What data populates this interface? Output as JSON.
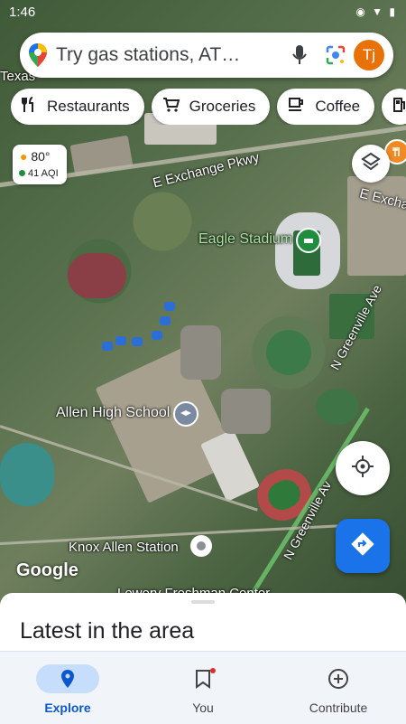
{
  "status_bar": {
    "time": "1:46",
    "system_icons": "◉ ▼ ▮"
  },
  "search": {
    "placeholder": "Try gas stations, AT…",
    "avatar_initials": "Tj"
  },
  "chips": [
    {
      "label": "Restaurants",
      "icon": "fork-knife-icon"
    },
    {
      "label": "Groceries",
      "icon": "cart-icon"
    },
    {
      "label": "Coffee",
      "icon": "coffee-icon"
    }
  ],
  "weather": {
    "temp": "80°",
    "aqi": "41 AQI"
  },
  "map_labels": {
    "road1": "E Exchange Pkwy",
    "road1_cont": "E Excha",
    "stadium": "Eagle Stadium",
    "school": "Allen High School",
    "station": "Knox Allen Station",
    "road2": "N Greenville Ave",
    "road3": "N Greenville Av",
    "partial_top": "Texas",
    "partial_bottom": "Lowery Freshman Center",
    "watermark": "Google"
  },
  "sheet": {
    "title": "Latest in the area"
  },
  "nav": [
    {
      "label": "Explore",
      "icon": "location-pin-icon",
      "active": true
    },
    {
      "label": "You",
      "icon": "bookmark-icon",
      "active": false
    },
    {
      "label": "Contribute",
      "icon": "add-circle-icon",
      "active": false
    }
  ],
  "colors": {
    "accent": "#1a73e8",
    "avatar": "#e8710a",
    "active_tab_bg": "#c7ddfc"
  }
}
